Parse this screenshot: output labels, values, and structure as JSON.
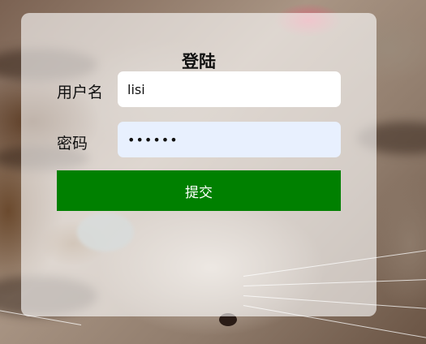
{
  "login_form": {
    "title": "登陆",
    "username_label": "用户名",
    "username_value": "lisi",
    "password_label": "密码",
    "password_value": "••••••",
    "submit_label": "提交"
  },
  "colors": {
    "submit_bg": "#008000",
    "password_autofill_bg": "#e8f0fe",
    "card_bg": "rgba(255,255,255,0.62)"
  }
}
